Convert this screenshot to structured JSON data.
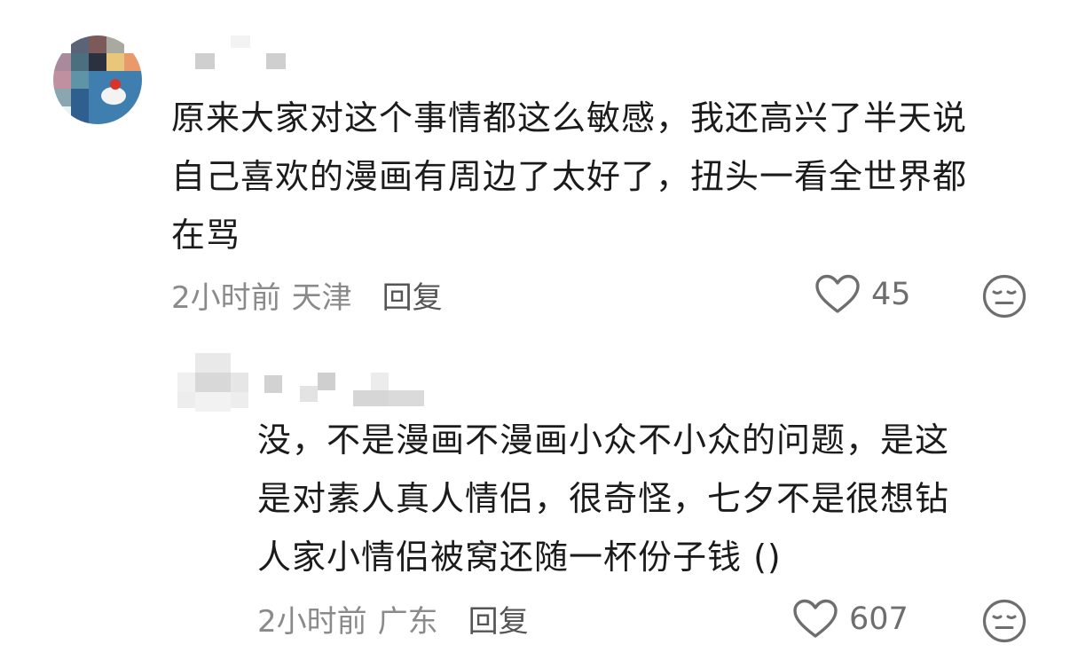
{
  "comments": [
    {
      "username": "",
      "text_lines": [
        "原来大家对这个事情都这么敏感，我还高兴了半天说",
        "自己喜欢的漫画有周边了太好了，扭头一看全世界都",
        "在骂"
      ],
      "time": "2小时前",
      "location": "天津",
      "reply_label": "回复",
      "likes": "45",
      "like_icon": "heart-outline-icon",
      "dislike_icon": "meh-face-icon"
    },
    {
      "username": "",
      "text_lines": [
        "没，不是漫画不漫画小众不小众的问题，是这",
        "是对素人真人情侣，很奇怪，七夕不是很想钻",
        "人家小情侣被窝还随一杯份子钱 ()"
      ],
      "time": "2小时前",
      "location": "广东",
      "reply_label": "回复",
      "likes": "607",
      "like_icon": "heart-outline-icon",
      "dislike_icon": "meh-face-icon"
    }
  ],
  "colors": {
    "text": "#1b1b1b",
    "meta": "#8a8a8a",
    "reply": "#555555",
    "icon": "#6e6e6e"
  }
}
